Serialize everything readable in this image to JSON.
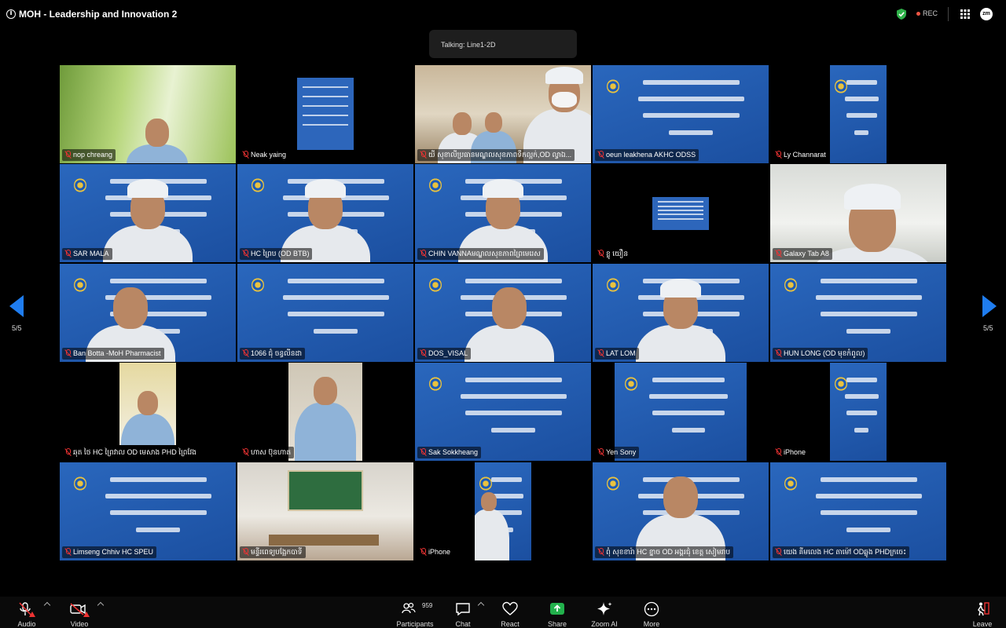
{
  "window": {
    "title": "MOH - Leadership and Innovation 2",
    "rec_label": "REC",
    "avatar_label": "zm"
  },
  "talking": "Talking: Line1-2D",
  "pagination": {
    "left": "5/5",
    "right": "5/5"
  },
  "slide_text": [
    "ការបណ្តុះបណ្តាលពីភាពជាអ្នកដឹកនាំ និងនវានុវត្តន៍",
    "សម្រាប់ការគ្រប់គ្រងសុខាភិបាល",
    "ឆ្នាំ ២០២៦"
  ],
  "participants": [
    {
      "name": "nop chreang"
    },
    {
      "name": "Neak yaing"
    },
    {
      "name": "យី សុខាលីប្រធានមណ្ឌលសុខភាពទឹកល្អក់,OD ល្វាឯ..."
    },
    {
      "name": "oeun leakhena AKHC ODSS"
    },
    {
      "name": "Ly Channarat"
    },
    {
      "name": "SAR MALA"
    },
    {
      "name": "HC ព្រៃប (OD BTB)"
    },
    {
      "name": "CHIN VANNAមណ្ឌលសុខភាពព្រៃមេរេស"
    },
    {
      "name": "ខ្លូ យឿន"
    },
    {
      "name": "Galaxy Tab A8"
    },
    {
      "name": "Ban Botta -MoH Pharmacist"
    },
    {
      "name": "1066 ជុំ ចន្ធលីនដា"
    },
    {
      "name": "DOS_VISAL"
    },
    {
      "name": "LAT LOM"
    },
    {
      "name": "HUN LONG (OD មុខកំពូល)"
    },
    {
      "name": "ឆុត ថៃ HC ព្រៃវាល OD មេសាង PHD ព្រៃវែង"
    },
    {
      "name": "ហាស ប៊ុនហាត"
    },
    {
      "name": "Sak Sokkheang"
    },
    {
      "name": "Yen Sony"
    },
    {
      "name": "iPhone"
    },
    {
      "name": "Limseng Chhiv HC SPEU"
    },
    {
      "name": "មន្ទីរពេទ្យបង្អែកបាទី"
    },
    {
      "name": "iPhone"
    },
    {
      "name": "ពុំ សុខខារ៉ា HC ខ្នាច OD អង្គរជុំ ខេត្ត សៀមរាប"
    },
    {
      "name": "យេង គីមលេង HC តាម៉ៅ ODឆ្លូង PHDក្រចេះ"
    }
  ],
  "toolbar": {
    "audio": "Audio",
    "video": "Video",
    "participants": "Participants",
    "participants_count": "959",
    "chat": "Chat",
    "react": "React",
    "share": "Share",
    "zoom_ai": "Zoom AI",
    "more": "More",
    "leave": "Leave"
  },
  "colors": {
    "slide_blue": "#1b4fa0",
    "share_green": "#22b14c",
    "nav_blue": "#1f7df0",
    "muted_red": "#e33333"
  }
}
